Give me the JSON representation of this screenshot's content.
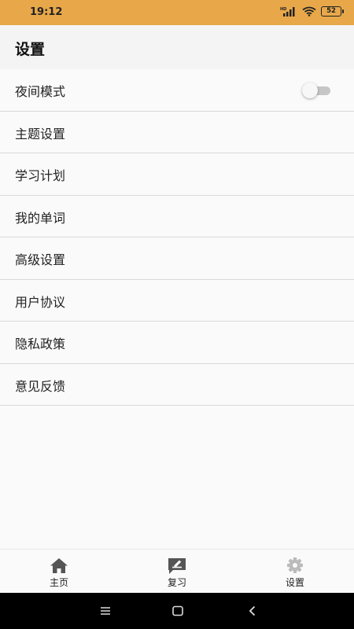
{
  "status_bar": {
    "time": "19:12",
    "battery": "52",
    "icons": [
      "hd-signal-icon",
      "wifi-icon",
      "battery-icon"
    ]
  },
  "header": {
    "title": "设置"
  },
  "settings": {
    "items": [
      {
        "label": "夜间模式",
        "has_toggle": true,
        "toggle_on": false
      },
      {
        "label": "主题设置"
      },
      {
        "label": "学习计划"
      },
      {
        "label": "我的单词"
      },
      {
        "label": "高级设置"
      },
      {
        "label": "用户协议"
      },
      {
        "label": "隐私政策"
      },
      {
        "label": "意见反馈"
      }
    ]
  },
  "bottom_nav": {
    "tabs": [
      {
        "label": "主页",
        "icon": "home-icon",
        "active": false
      },
      {
        "label": "复习",
        "icon": "review-icon",
        "active": false
      },
      {
        "label": "设置",
        "icon": "gear-icon",
        "active": true
      }
    ]
  },
  "system_nav": {
    "buttons": [
      "menu-icon",
      "home-square-icon",
      "back-icon"
    ]
  },
  "colors": {
    "status_bar": "#e8a84a",
    "background": "#fafafa",
    "divider": "#d9d9d9",
    "icon": "#555555",
    "icon_inactive": "#bbbbbb"
  }
}
